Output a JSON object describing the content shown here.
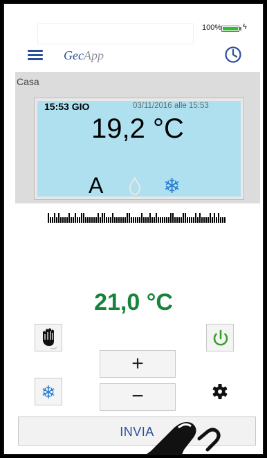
{
  "status_bar": {
    "battery_text": "100%",
    "battery_level": 1.0
  },
  "app_bar": {
    "brand_prefix": "Gec",
    "brand_suffix": "App"
  },
  "thermostat": {
    "label": "Casa",
    "time": "15:53 GIO",
    "last_update": "03/11/2016 alle 15:53",
    "temperature": "19,2 °C",
    "mode": "A"
  },
  "setpoint": "21,0 °C",
  "controls": {
    "plus": "+",
    "minus": "−",
    "send": "INVIA"
  },
  "colors": {
    "accent": "#2a4f9a",
    "setpoint": "#17843c",
    "power": "#3b9c2c",
    "lcd": "#aee0f0"
  },
  "icons": [
    "menu-icon",
    "clock-icon",
    "flame-icon",
    "snowflake-icon",
    "hand-icon",
    "power-icon",
    "gear-icon",
    "finger-pointer-icon"
  ]
}
